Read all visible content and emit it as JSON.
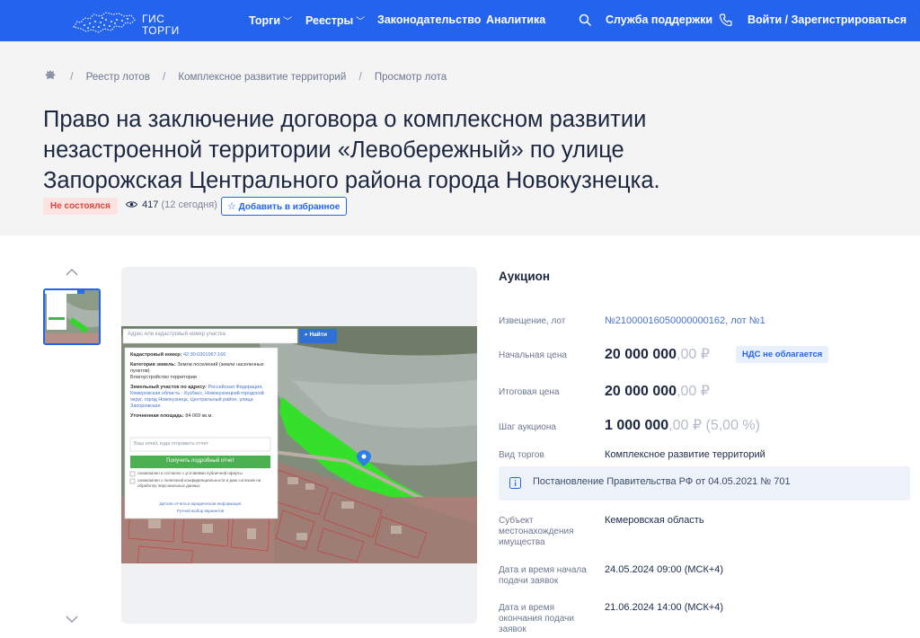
{
  "topbar": {
    "logo_line1": "ГИС",
    "logo_line2": "ТОРГИ",
    "nav": [
      {
        "label": "Торги",
        "dropdown": true
      },
      {
        "label": "Реестры",
        "dropdown": true
      },
      {
        "label": "Законодательство",
        "dropdown": false
      },
      {
        "label": "Аналитика",
        "dropdown": false
      }
    ],
    "support": "Служба поддержки",
    "login": "Войти / Зарегистрироваться",
    "colors": {
      "primary": "#2463eb"
    }
  },
  "breadcrumbs": [
    "Реестр лотов",
    "Комплексное развитие территорий",
    "Просмотр лота"
  ],
  "title": "Право на заключение договора о комплексном развитии незастроенной территории «Левобережный» по улице Запорожская Центрального района города Новокузнецка.",
  "status": "Не состоялся",
  "views": {
    "count": "417",
    "today": "(12 сегодня)"
  },
  "favorite_label": "Добавить в избранное",
  "map_panel": {
    "search_placeholder": "Адрес или кадастровый номер участка",
    "search_button": "Найти",
    "cadastral_label": "Кадастровый номер:",
    "cadastral_value": "42:30:0301067:166",
    "category_label": "Категория земель:",
    "category_value": "Земли поселений (земли населенных пунктов)",
    "category_extra": "Благоустройство территории",
    "address_label": "Земельный участок по адресу:",
    "address_value": "Российская Федерация, Кемеровская область - Кузбасс, Новокузнецкий городской округ, город Новокузнецк, Центральный район, улица Запорожская",
    "area_label": "Уточненная площадь:",
    "area_value": "84 069 кв.м.",
    "email_placeholder": "Ваш email, куда отправить отчет",
    "report_button": "Получить подробный отчет",
    "consent1": "ознакомлен и согласен с условиями публичной оферты",
    "consent2": "ознакомлен с политикой конфиденциальности и даю согласие на обработку персональных данных",
    "link1": "Детали отчета и юридическая информация",
    "link2": "Ручной выбор вариантов"
  },
  "lot": {
    "type": "Аукцион",
    "notice_label": "Извещение, лот",
    "notice_value": "№21000016050000000162, лот №1",
    "start_price_label": "Начальная цена",
    "start_price_main": "20 000 000",
    "start_price_cents": ",00 ₽",
    "vat": "НДС не облагается",
    "final_price_label": "Итоговая цена",
    "final_price_main": "20 000 000",
    "final_price_cents": ",00 ₽",
    "step_label": "Шаг аукциона",
    "step_main": "1 000 000",
    "step_cents": ",00 ₽ (5,00 %)",
    "kind_label": "Вид торгов",
    "kind_value": "Комплексное развитие территорий",
    "decree": "Постановление Правительства РФ от 04.05.2021 № 701",
    "subject_label": "Субъект местонахождения имущества",
    "subject_value": "Кемеровская область",
    "start_date_label": "Дата и время начала подачи заявок",
    "start_date_value": "24.05.2024 09:00 (МСК+4)",
    "end_date_label": "Дата и время окончания подачи заявок",
    "end_date_value": "21.06.2024 14:00 (МСК+4)"
  }
}
